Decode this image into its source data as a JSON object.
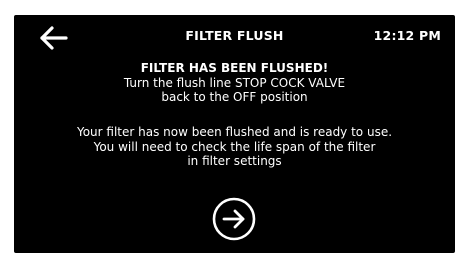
{
  "header": {
    "back_icon": "arrow-left-icon",
    "title": "FILTER FLUSH",
    "time": "12:12 PM"
  },
  "message": {
    "headline": "FILTER HAS BEEN FLUSHED!",
    "instruction_line1": "Turn the flush line STOP COCK VALVE",
    "instruction_line2": "back to the OFF position",
    "info_line1": "Your filter has now been flushed and is ready to use.",
    "info_line2": "You will need to check the life span of the filter",
    "info_line3": "in filter settings"
  },
  "footer": {
    "next_icon": "arrow-right-circle-icon"
  },
  "colors": {
    "background": "#000000",
    "text": "#ffffff"
  }
}
